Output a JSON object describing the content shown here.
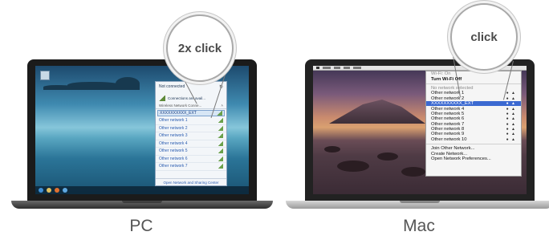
{
  "pc": {
    "caption": "PC",
    "callout": "2x click",
    "flyout": {
      "status": "Not connected",
      "connections_text": "Connections are avail...",
      "section_label": "Wireless Network Conne...",
      "selected_network": "XXXXXXXXXX_EXT",
      "networks": [
        "Other network 1",
        "Other network 2",
        "Other network 3",
        "Other network 4",
        "Other network 5",
        "Other network 6",
        "Other network 7"
      ],
      "footer": "Open Network and Sharing Center"
    }
  },
  "mac": {
    "caption": "Mac",
    "callout": "click",
    "menu": {
      "wifi_status": "Wi-Fi: On",
      "toggle": "Turn Wi-Fi Off",
      "no_selection": "No network selected",
      "networks_top": [
        "Other network 1",
        "Other network 2"
      ],
      "selected_network": "XXXXXXXXXX_EXT",
      "networks_bottom": [
        "Other network 4",
        "Other network 5",
        "Other network 6",
        "Other network 7",
        "Other network 8",
        "Other network 9",
        "Other network 10"
      ],
      "join_other": "Join Other Network...",
      "create": "Create Network...",
      "preferences": "Open Network Preferences..."
    }
  }
}
